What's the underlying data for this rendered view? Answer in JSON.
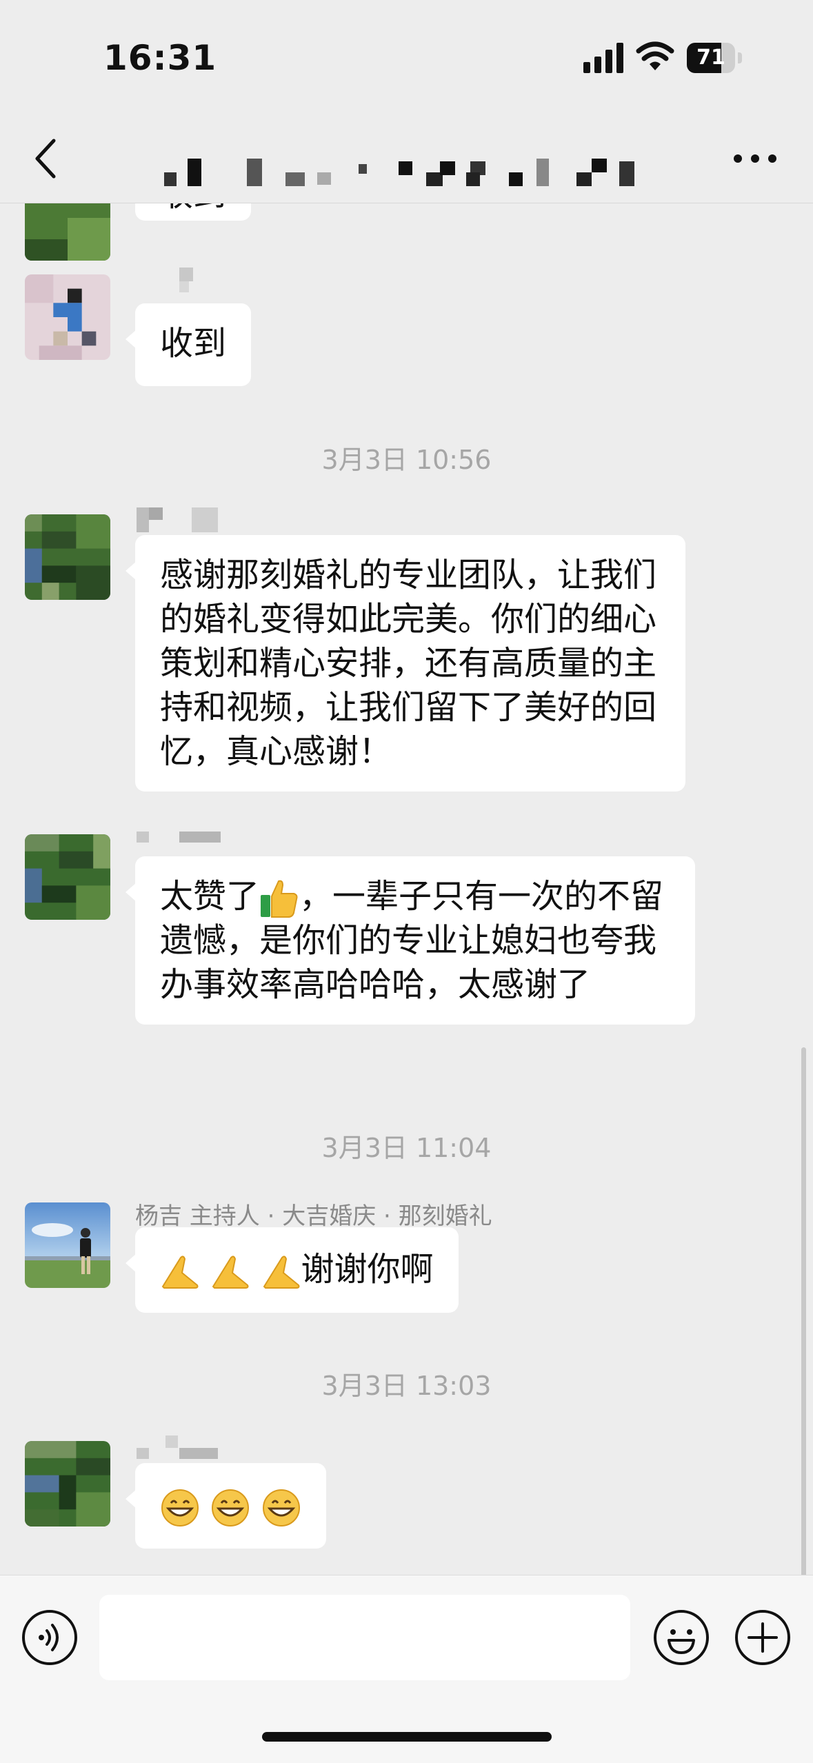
{
  "status_bar": {
    "time": "16:31",
    "battery_percent": "71",
    "battery_level": 0.71
  },
  "header": {
    "title": "",
    "back_icon": "chevron-left-icon",
    "more_icon": "ellipsis-icon"
  },
  "messages": [
    {
      "type": "message",
      "sender": "",
      "text": "收到",
      "avatar": "pixelated-avatar-green"
    },
    {
      "type": "message",
      "sender": "",
      "text": "收到",
      "avatar": "pixelated-avatar-pink"
    },
    {
      "type": "timestamp",
      "text": "3月3日 10:56"
    },
    {
      "type": "message",
      "sender": "",
      "text": "感谢那刻婚礼的专业团队，让我们的婚礼变得如此完美。你们的细心策划和精心安排，还有高质量的主持和视频，让我们留下了美好的回忆，真心感谢！",
      "avatar": "pixelated-avatar-green"
    },
    {
      "type": "message",
      "sender": "",
      "text_before": "太赞了",
      "emoji": "thumbs-up-icon",
      "text_after": "，一辈子只有一次的不留遗憾，是你们的专业让媳妇也夸我办事效率高哈哈哈，太感谢了",
      "avatar": "pixelated-avatar-green"
    },
    {
      "type": "timestamp",
      "text": "3月3日 11:04"
    },
    {
      "type": "message",
      "sender": "杨吉 主持人 · 大吉婚庆 · 那刻婚礼",
      "emoji": "folded-hands-icon",
      "emoji_count": 3,
      "text": "谢谢你啊",
      "avatar": "photo-avatar-man-on-grassland"
    },
    {
      "type": "timestamp",
      "text": "3月3日 13:03"
    },
    {
      "type": "message",
      "sender": "",
      "emoji": "grinning-face-icon",
      "emoji_count": 3,
      "avatar": "pixelated-avatar-green"
    }
  ],
  "input_bar": {
    "placeholder": "",
    "value": ""
  },
  "colors": {
    "background": "#ededed",
    "bubble": "#ffffff",
    "timestamp": "#a6a6a6"
  }
}
